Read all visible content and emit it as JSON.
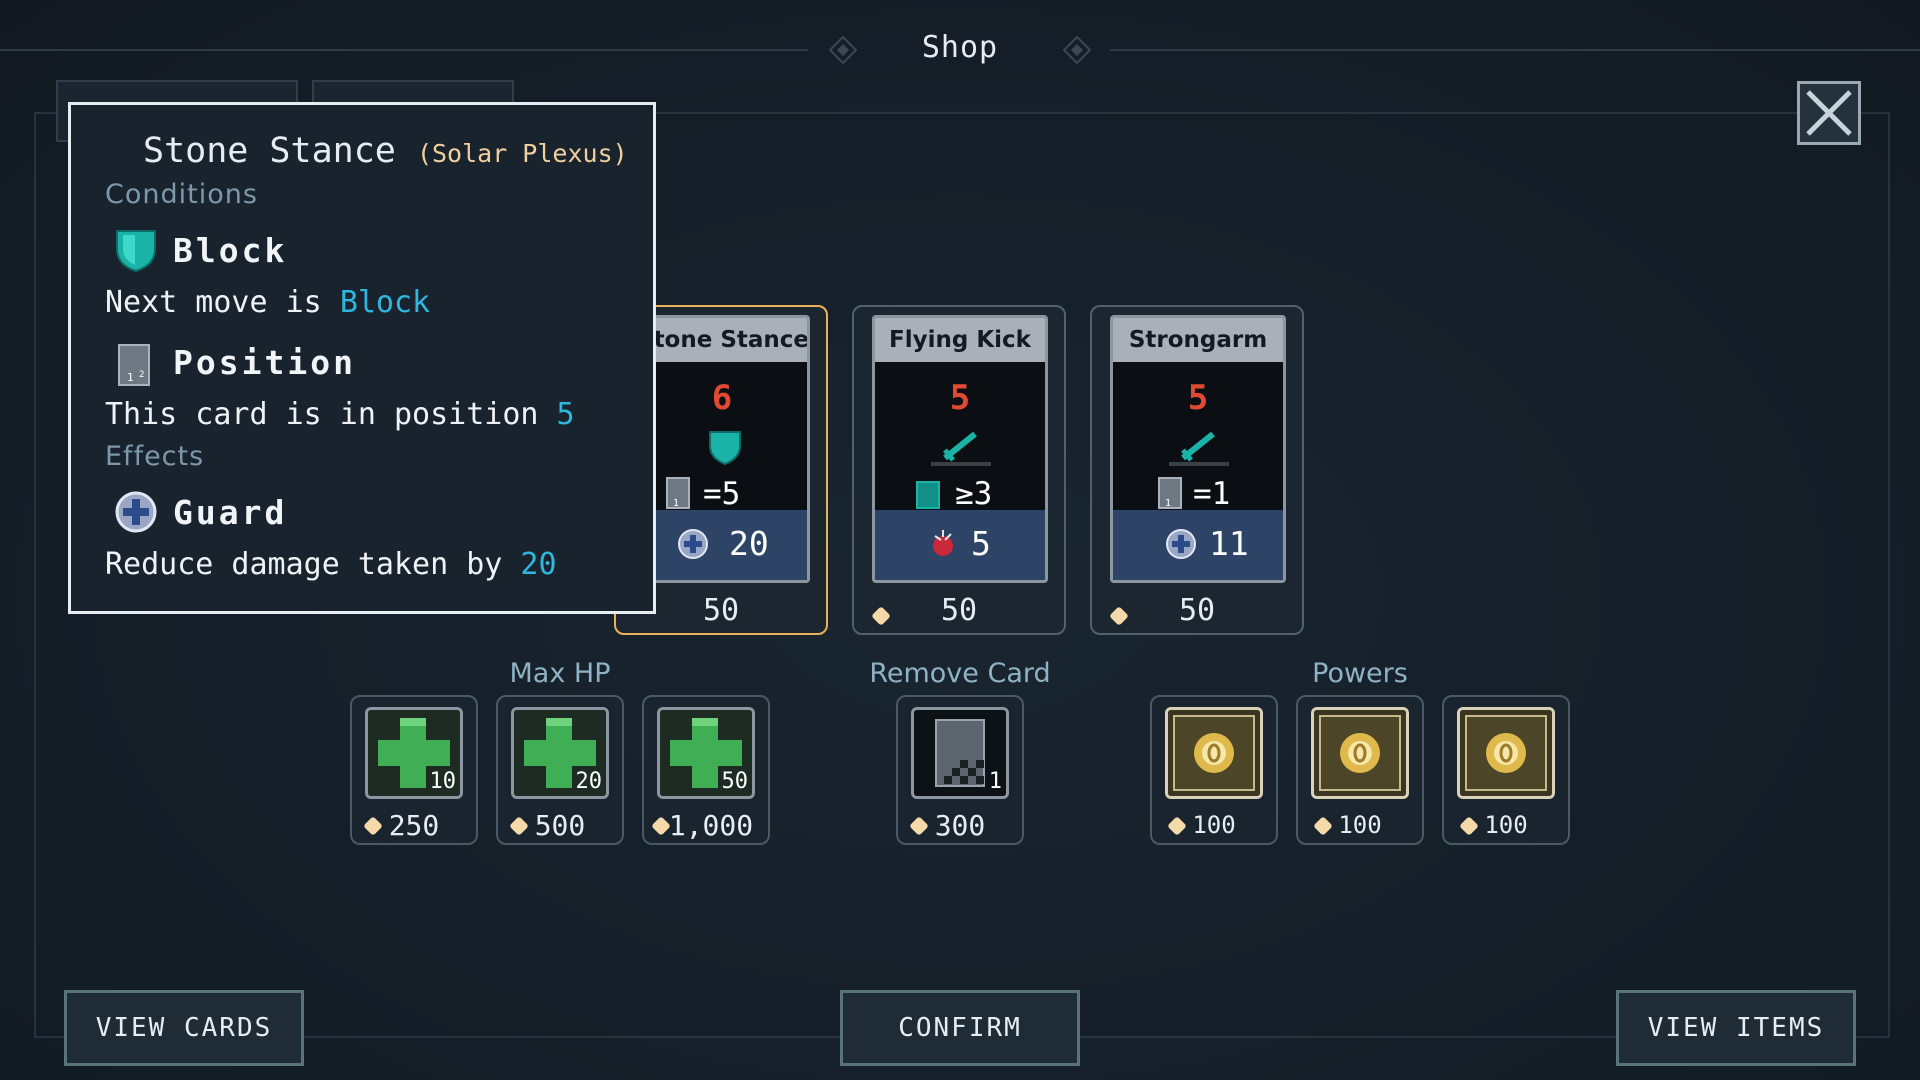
{
  "header": {
    "title": "Shop"
  },
  "tooltip": {
    "title": "Stone Stance",
    "subtitle": "(Solar Plexus)",
    "conditions_label": "Conditions",
    "effects_label": "Effects",
    "block": {
      "keyword": "Block",
      "text_prefix": "Next move is ",
      "text_value": "Block"
    },
    "position": {
      "keyword": "Position",
      "text_prefix": "This card is in position ",
      "text_value": "5"
    },
    "guard": {
      "keyword": "Guard",
      "text_prefix": "Reduce damage taken by ",
      "text_value": "20"
    }
  },
  "cards": [
    {
      "name": "Stone Stance",
      "cost": "6",
      "position_rule": "=5",
      "effect_value": "20",
      "price": "50",
      "selected": true
    },
    {
      "name": "Flying Kick",
      "cost": "5",
      "position_rule": "≥3",
      "effect_value": "5",
      "price": "50",
      "selected": false
    },
    {
      "name": "Strongarm",
      "cost": "5",
      "position_rule": "=1",
      "effect_value": "11",
      "price": "50",
      "selected": false
    }
  ],
  "sections": {
    "max_hp": "Max HP",
    "remove_card": "Remove Card",
    "powers": "Powers"
  },
  "max_hp_items": [
    {
      "amount": "10",
      "price": "250"
    },
    {
      "amount": "20",
      "price": "500"
    },
    {
      "amount": "50",
      "price": "1,000"
    }
  ],
  "remove_card_item": {
    "amount": "1",
    "price": "300"
  },
  "power_items": [
    {
      "price": "100"
    },
    {
      "price": "100"
    },
    {
      "price": "100"
    }
  ],
  "buttons": {
    "view_cards": "VIEW CARDS",
    "confirm": "CONFIRM",
    "view_items": "VIEW ITEMS"
  },
  "colors": {
    "accent": "#2fb7e0",
    "cost_red": "#e04a32",
    "selected_border": "#e9b15a",
    "coin": "#f5d9a8"
  }
}
